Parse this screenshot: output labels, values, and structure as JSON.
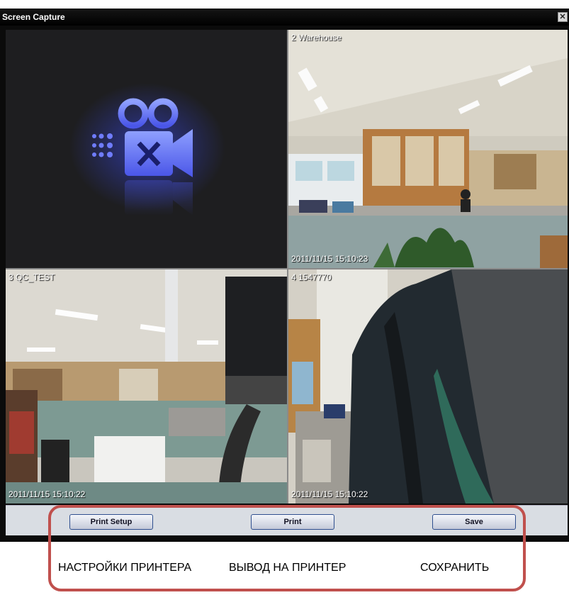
{
  "window": {
    "title": "Screen Capture",
    "close_glyph": "✕"
  },
  "cameras": [
    {
      "label": "",
      "timestamp": "",
      "state": "no-video",
      "icon": "camera-off-icon"
    },
    {
      "label": "2 Warehouse",
      "timestamp": "2011/11/15 15:10:23"
    },
    {
      "label": "3 QC_TEST",
      "timestamp": "2011/11/15 15:10:22"
    },
    {
      "label": "4 1547770",
      "timestamp": "2011/11/15 15:10:22"
    }
  ],
  "toolbar": {
    "print_setup_label": "Print Setup",
    "print_label": "Print",
    "save_label": "Save"
  },
  "captions": {
    "print_setup": "НАСТРОЙКИ ПРИНТЕРА",
    "print": "ВЫВОД НА ПРИНТЕР",
    "save": "СОХРАНИТЬ"
  },
  "colors": {
    "annotation": "#c0504d",
    "button_border": "#2f4f8f",
    "icon_blue": "#5a6cff"
  }
}
